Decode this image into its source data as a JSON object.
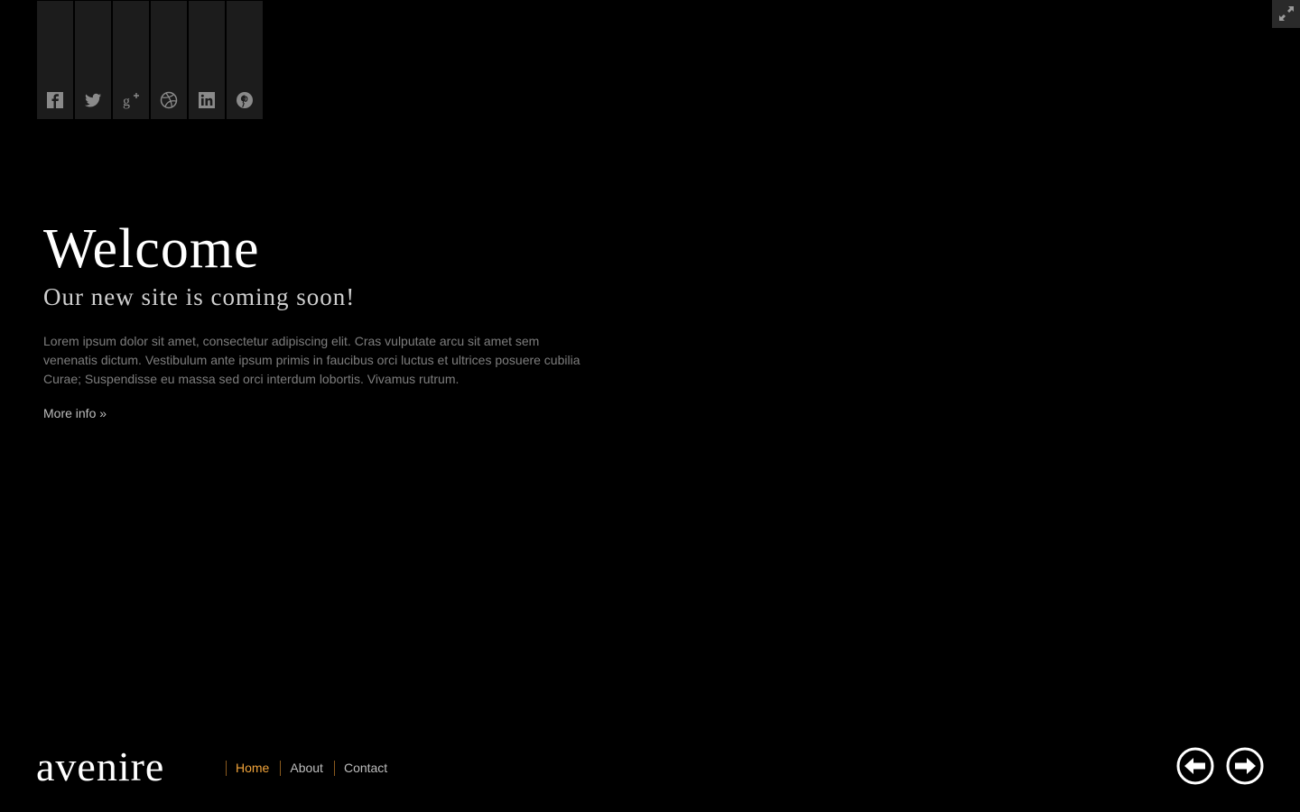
{
  "social": {
    "items": [
      {
        "name": "facebook-icon"
      },
      {
        "name": "twitter-icon"
      },
      {
        "name": "google-plus-icon"
      },
      {
        "name": "dribbble-icon"
      },
      {
        "name": "linkedin-icon"
      },
      {
        "name": "pinterest-icon"
      }
    ]
  },
  "fullscreen": {
    "icon": "expand-icon"
  },
  "hero": {
    "title": "Welcome",
    "subtitle": "Our new site is coming soon!",
    "body": "Lorem ipsum dolor sit amet, consectetur adipiscing elit. Cras vulputate arcu sit amet sem venenatis dictum. Vestibulum ante ipsum primis in faucibus orci luctus et ultrices posuere cubilia Curae; Suspendisse eu massa sed orci interdum lobortis. Vivamus rutrum.",
    "more_link": "More info »"
  },
  "footer": {
    "logo": "avenire",
    "nav": [
      {
        "label": "Home",
        "active": true
      },
      {
        "label": "About",
        "active": false
      },
      {
        "label": "Contact",
        "active": false
      }
    ],
    "prev_icon": "arrow-left-circle-icon",
    "next_icon": "arrow-right-circle-icon"
  },
  "colors": {
    "background": "#000000",
    "accent": "#f0a33a",
    "tab_bg": "#1c1c1c",
    "icon_gray": "#8a8a8a"
  }
}
